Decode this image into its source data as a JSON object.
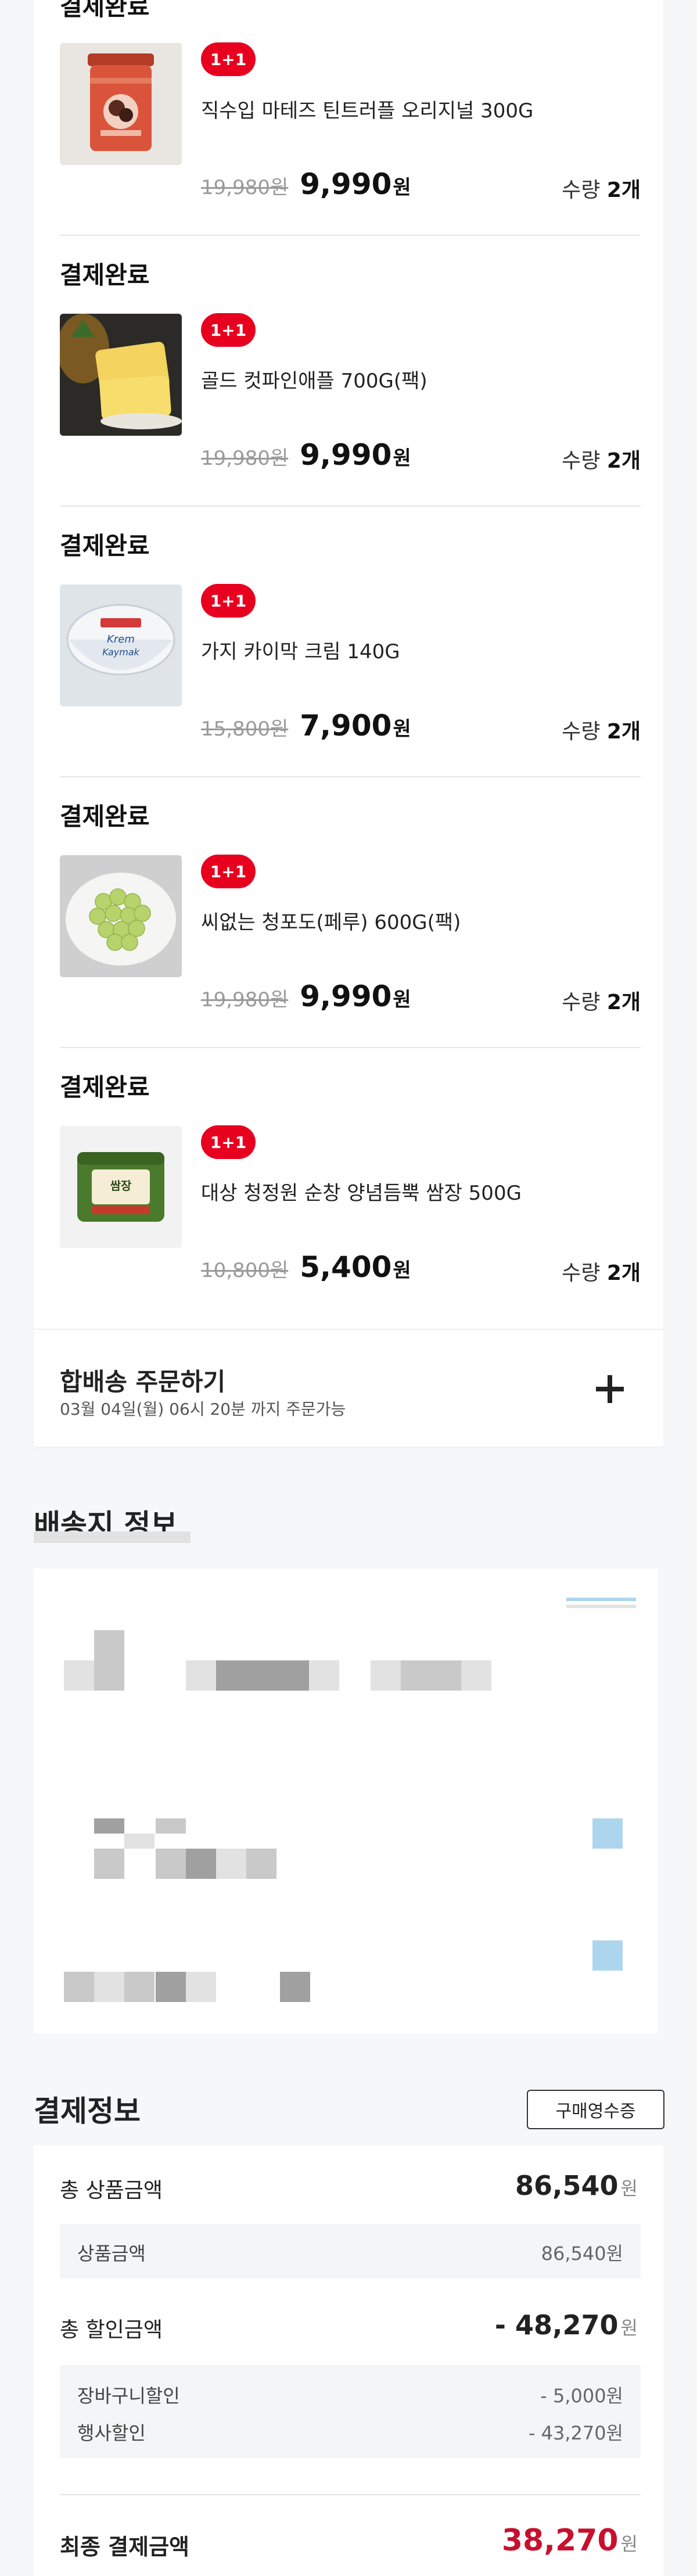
{
  "order": {
    "items": [
      {
        "status": "결제완료",
        "badge": "1+1",
        "name": "직수입 마테즈 틴트러플 오리지널 300G",
        "original_price": "19,980원",
        "sale_price": "9,990",
        "currency": "원",
        "qty_label": "수량",
        "qty_value": "2개",
        "thumb_icon": "truffle-tin-image"
      },
      {
        "status": "결제완료",
        "badge": "1+1",
        "name": "골드 컷파인애플 700G(팩)",
        "original_price": "19,980원",
        "sale_price": "9,990",
        "currency": "원",
        "qty_label": "수량",
        "qty_value": "2개",
        "thumb_icon": "pineapple-image"
      },
      {
        "status": "결제완료",
        "badge": "1+1",
        "name": "가지 카이막 크림 140G",
        "original_price": "15,800원",
        "sale_price": "7,900",
        "currency": "원",
        "qty_label": "수량",
        "qty_value": "2개",
        "thumb_icon": "kaymak-cup-image"
      },
      {
        "status": "결제완료",
        "badge": "1+1",
        "name": "씨없는 청포도(페루) 600G(팩)",
        "original_price": "19,980원",
        "sale_price": "9,990",
        "currency": "원",
        "qty_label": "수량",
        "qty_value": "2개",
        "thumb_icon": "green-grapes-image"
      },
      {
        "status": "결제완료",
        "badge": "1+1",
        "name": "대상 청정원 순창 양념듬뿍 쌈장 500G",
        "original_price": "10,800원",
        "sale_price": "5,400",
        "currency": "원",
        "qty_label": "수량",
        "qty_value": "2개",
        "thumb_icon": "ssamjang-tub-image"
      }
    ],
    "bundle": {
      "title": "합배송 주문하기",
      "subtitle": "03월 04일(월) 06시 20분 까지 주문가능",
      "icon": "plus-icon"
    }
  },
  "delivery": {
    "title": "배송지 정보"
  },
  "payment": {
    "title": "결제정보",
    "receipt_button": "구매영수증",
    "total_product": {
      "label": "총 상품금액",
      "value": "86,540",
      "unit": "원"
    },
    "product_amount": {
      "label": "상품금액",
      "value": "86,540원"
    },
    "total_discount": {
      "label": "총 할인금액",
      "value": "- 48,270",
      "unit": "원"
    },
    "cart_discount": {
      "label": "장바구니할인",
      "value": "- 5,000원"
    },
    "event_discount": {
      "label": "행사할인",
      "value": "- 43,270원"
    },
    "final": {
      "label": "최종 결제금액",
      "value": "38,270",
      "unit": "원"
    }
  },
  "colors": {
    "accent": "#e8001f",
    "final_price": "#c8102e"
  }
}
